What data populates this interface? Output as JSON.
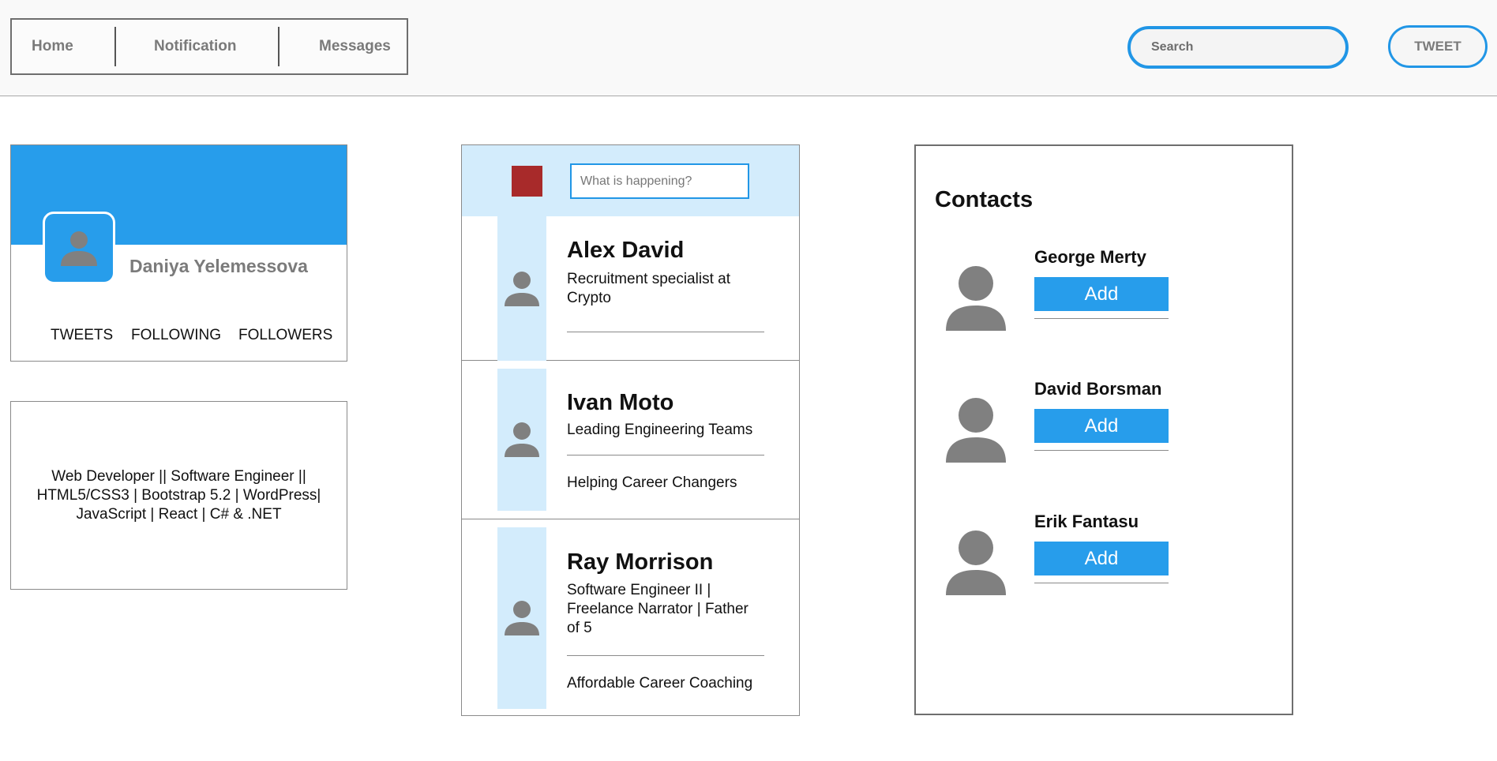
{
  "nav": {
    "home": "Home",
    "notification": "Notification",
    "messages": "Messages"
  },
  "search": {
    "placeholder": "Search"
  },
  "tweet_button": "TWEET",
  "profile": {
    "name": "Daniya Yelemessova",
    "stats": {
      "tweets": "TWEETS",
      "following": "FOLLOWING",
      "followers": "FOLLOWERS"
    },
    "bio": "Web Developer || Software Engineer || HTML5/CSS3 | Bootstrap 5.2 | WordPress| JavaScript | React | C# & .NET"
  },
  "composer": {
    "placeholder": "What is happening?"
  },
  "posts": [
    {
      "name": "Alex David",
      "title": "Recruitment specialist at Crypto",
      "extra": ""
    },
    {
      "name": "Ivan Moto",
      "title": "Leading Engineering Teams",
      "extra": "Helping Career Changers"
    },
    {
      "name": "Ray Morrison",
      "title": "Software Engineer II | Freelance Narrator | Father of 5",
      "extra": "Affordable Career Coaching"
    }
  ],
  "contacts": {
    "title": "Contacts",
    "add_label": "Add",
    "items": [
      {
        "name": "George Merty"
      },
      {
        "name": "David Borsman"
      },
      {
        "name": "Erik Fantasu"
      }
    ]
  },
  "colors": {
    "accent": "#279deb",
    "accent_light": "#d3ecfc",
    "composer_square": "#a82a2a",
    "avatar_gray": "#808080"
  }
}
